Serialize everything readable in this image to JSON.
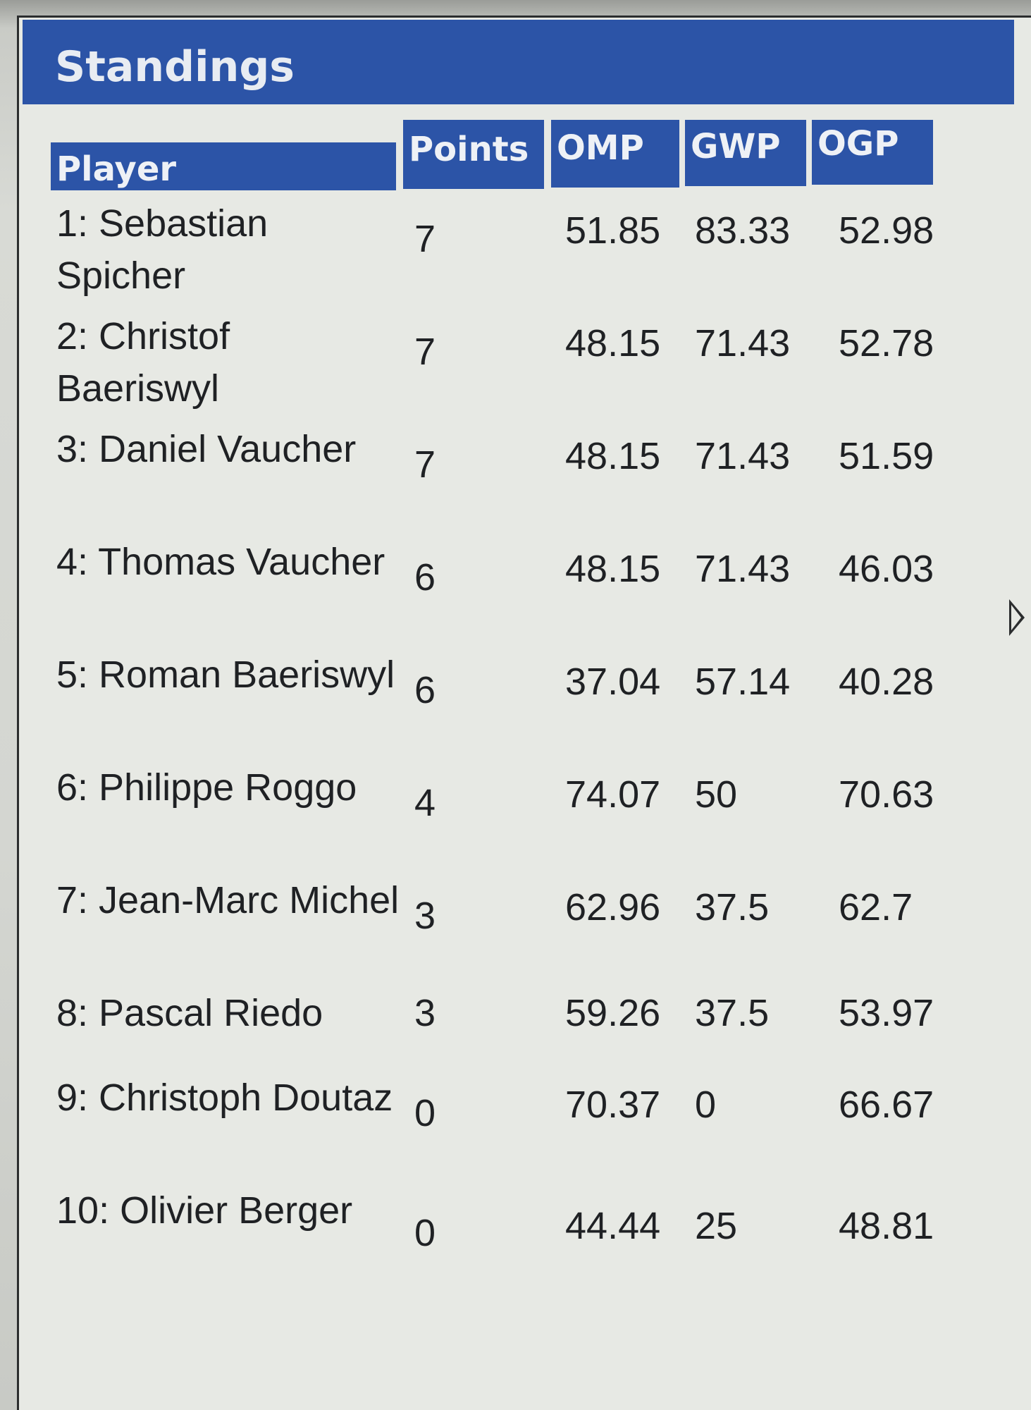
{
  "panel": {
    "title": "Standings"
  },
  "table": {
    "columns": [
      "Player",
      "Points",
      "OMP",
      "GWP",
      "OGP"
    ],
    "rows": [
      {
        "player": "1: Sebastian Spicher",
        "points": "7",
        "omp": "51.85",
        "gwp": "83.33",
        "ogp": "52.98"
      },
      {
        "player": "2: Christof Baeriswyl",
        "points": "7",
        "omp": "48.15",
        "gwp": "71.43",
        "ogp": "52.78"
      },
      {
        "player": "3: Daniel Vaucher",
        "points": "7",
        "omp": "48.15",
        "gwp": "71.43",
        "ogp": "51.59"
      },
      {
        "player": "4: Thomas Vaucher",
        "points": "6",
        "omp": "48.15",
        "gwp": "71.43",
        "ogp": "46.03"
      },
      {
        "player": "5: Roman Baeriswyl",
        "points": "6",
        "omp": "37.04",
        "gwp": "57.14",
        "ogp": "40.28"
      },
      {
        "player": "6: Philippe Roggo",
        "points": "4",
        "omp": "74.07",
        "gwp": "50",
        "ogp": "70.63"
      },
      {
        "player": "7: Jean-Marc Michel",
        "points": "3",
        "omp": "62.96",
        "gwp": "37.5",
        "ogp": "62.7"
      },
      {
        "player": "8: Pascal Riedo",
        "points": "3",
        "omp": "59.26",
        "gwp": "37.5",
        "ogp": "53.97"
      },
      {
        "player": "9: Christoph Doutaz",
        "points": "0",
        "omp": "70.37",
        "gwp": "0",
        "ogp": "66.67"
      },
      {
        "player": "10: Olivier Berger",
        "points": "0",
        "omp": "44.44",
        "gwp": "25",
        "ogp": "48.81"
      }
    ]
  },
  "icons": {
    "cursor": "mouse-pointer-icon"
  },
  "colors": {
    "header_bg": "#2c54a7",
    "header_text": "#eef1f6",
    "body_bg": "#e7e9e4",
    "body_text": "#1f2124"
  }
}
